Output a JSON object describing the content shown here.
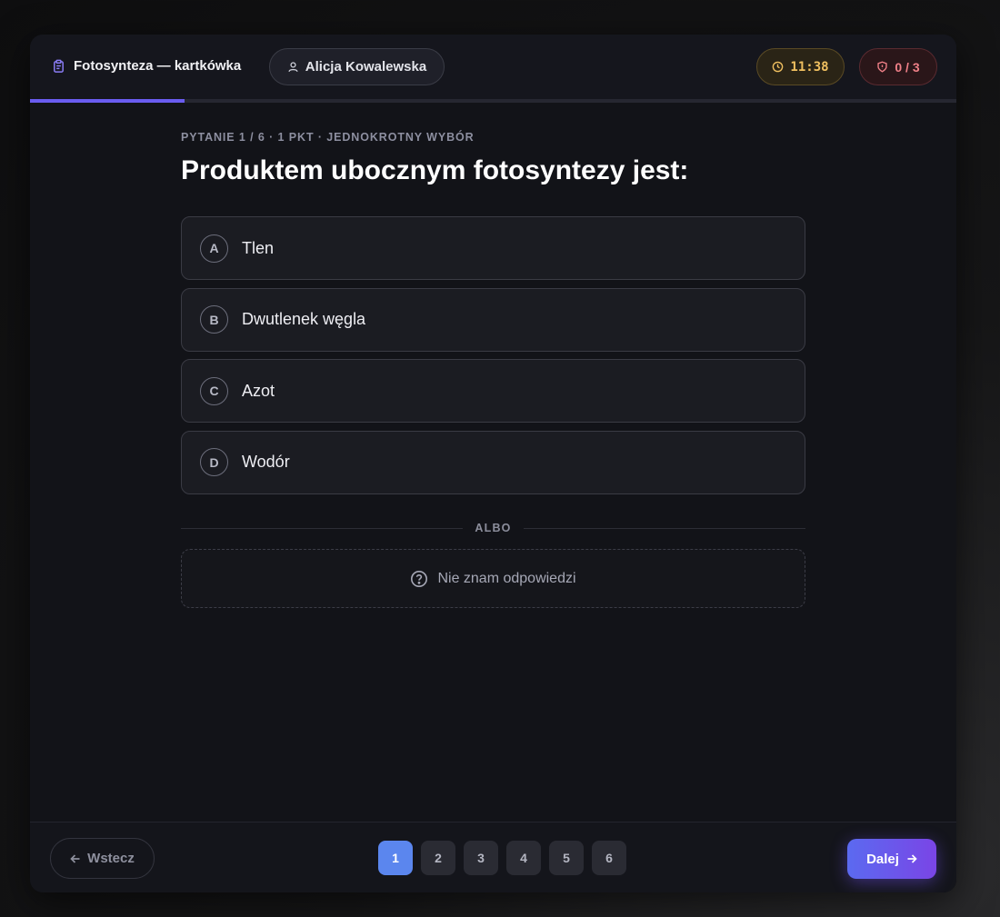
{
  "header": {
    "title": "Fotosynteza — kartkówka",
    "student": "Alicja Kowalewska",
    "timer": "11:38",
    "violations": "0 / 3"
  },
  "progress": {
    "fraction": 0.1667
  },
  "question": {
    "meta": "PYTANIE 1 / 6 · 1 PKT · JEDNOKROTNY WYBÓR",
    "text": "Produktem ubocznym fotosyntezy jest:",
    "options": [
      {
        "letter": "A",
        "label": "Tlen"
      },
      {
        "letter": "B",
        "label": "Dwutlenek węgla"
      },
      {
        "letter": "C",
        "label": "Azot"
      },
      {
        "letter": "D",
        "label": "Wodór"
      }
    ],
    "divider": "ALBO",
    "dont_know": "Nie znam odpowiedzi"
  },
  "footer": {
    "back_label": "Wstecz",
    "next_label": "Dalej",
    "pages": [
      "1",
      "2",
      "3",
      "4",
      "5",
      "6"
    ],
    "active_page": "1"
  },
  "colors": {
    "accent": "#6a5cf0",
    "active_page": "#5b86ee",
    "timer": "#f0c060",
    "violations": "#f08088"
  },
  "icons": {
    "title": "clipboard-icon",
    "student": "user-icon",
    "timer": "clock-icon",
    "violations": "shield-icon",
    "dont_know": "question-circle-icon",
    "back": "arrow-left-icon",
    "next": "arrow-right-icon"
  }
}
